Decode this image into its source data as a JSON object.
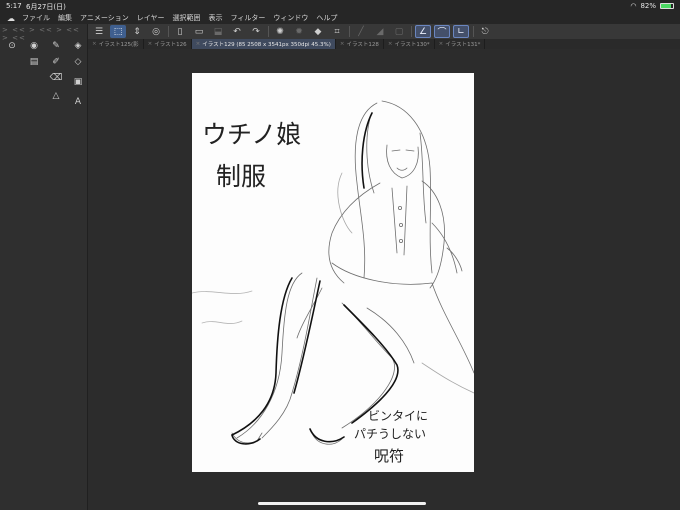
{
  "status": {
    "time": "5:17",
    "date": "6月27日(日)",
    "battery_percent": "82%",
    "battery_level": 0.82
  },
  "menu": {
    "items": [
      "ファイル",
      "編集",
      "アニメーション",
      "レイヤー",
      "選択範囲",
      "表示",
      "フィルター",
      "ウィンドウ",
      "ヘルプ"
    ]
  },
  "left_panel": {
    "arrows": "> <<   > <<   > <<   > <<"
  },
  "tabs": [
    {
      "label": "イラスト125(影"
    },
    {
      "label": "イラスト126"
    },
    {
      "label": "イラスト129 (85 2508 x 3541px 350dpi 45.3%)"
    },
    {
      "label": "イラスト128"
    },
    {
      "label": "イラスト130*"
    },
    {
      "label": "イラスト131*"
    }
  ],
  "canvas": {
    "title_line1": "ウチノ娘",
    "title_line2": "制服",
    "note_line1": "ビンタイに",
    "note_line2": "パチうしない",
    "note_line3": "呪符"
  }
}
